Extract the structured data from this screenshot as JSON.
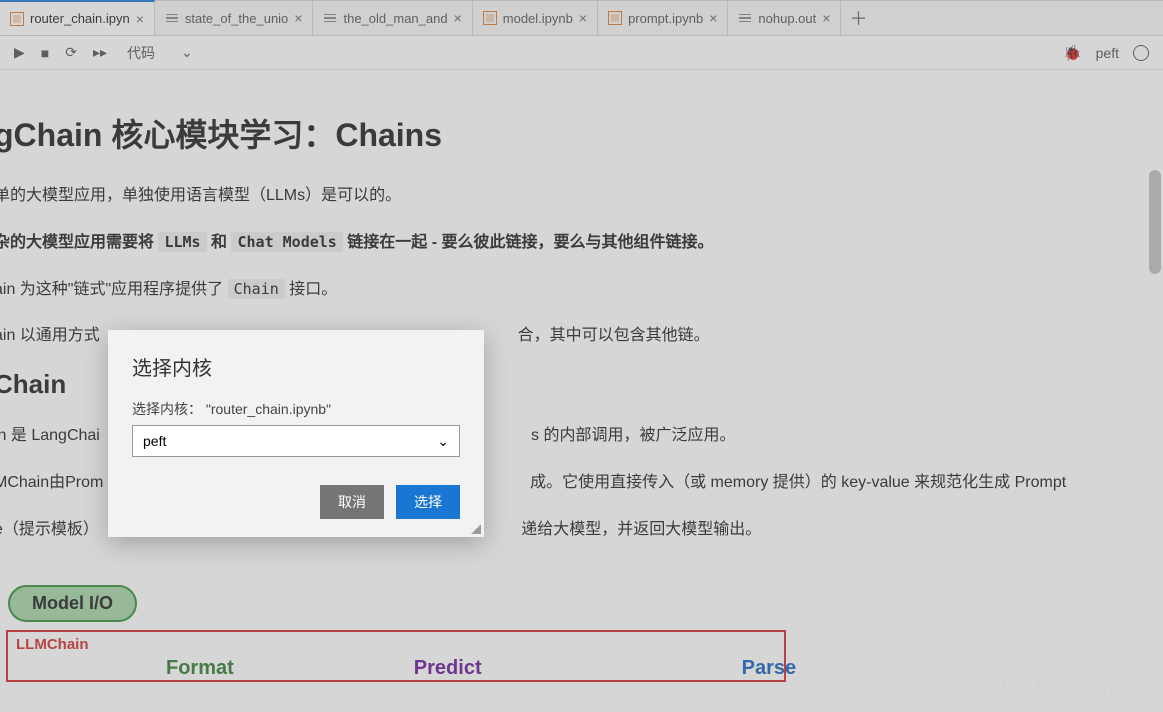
{
  "tabs": [
    {
      "label": "router_chain.ipyn",
      "kind": "notebook",
      "active": true
    },
    {
      "label": "state_of_the_unio",
      "kind": "text",
      "active": false
    },
    {
      "label": "the_old_man_and",
      "kind": "text",
      "active": false
    },
    {
      "label": "model.ipynb",
      "kind": "notebook",
      "active": false
    },
    {
      "label": "prompt.ipynb",
      "kind": "notebook",
      "active": false
    },
    {
      "label": "nohup.out",
      "kind": "text",
      "active": false
    }
  ],
  "toolbar": {
    "cell_type": "代码",
    "kernel_name_right": "peft"
  },
  "content": {
    "h1": "gChain 核心模块学习：Chains",
    "p1": "单的大模型应用，单独使用语言模型（LLMs）是可以的。",
    "p2_prefix": "杂的大模型应用需要将 ",
    "p2_code1": "LLMs",
    "p2_mid": " 和 ",
    "p2_code2": "Chat Models",
    "p2_suffix": " 链接在一起 - 要么彼此链接，要么与其他组件链接。",
    "p3_prefix": "ain 为这种\"链式\"应用程序提供了 ",
    "p3_code": "Chain",
    "p3_suffix": " 接口。",
    "p4": "ain 以通用方式                                                                                              合，其中可以包含其他链。",
    "h2": "Chain",
    "p5": "in 是 LangChai                                                                                                 s 的内部调用，被广泛应用。",
    "p6": "MChain由Prom                                                                                                成。它使用直接传入（或 memory 提供）的 key-value 来规范化生成 Prompt",
    "p7": "e（提示模板）                                                                                               递给大模型，并返回大模型输出。",
    "pill": "Model I/O",
    "redbox_label": "LLMChain",
    "cols": {
      "format": "Format",
      "predict": "Predict",
      "parse": "Parse"
    }
  },
  "dialog": {
    "title": "选择内核",
    "label_prefix": "选择内核：",
    "file_ref": "\"router_chain.ipynb\"",
    "selected": "peft",
    "cancel": "取消",
    "confirm": "选择"
  },
  "watermark": "CSDN @爱学习的小道长",
  "icons": {
    "run": "▶",
    "stop": "■",
    "restart": "⟳",
    "advance": "▸▸",
    "chevron_down": "⌄",
    "close": "×",
    "plus": "＋",
    "bug": "🐞"
  }
}
